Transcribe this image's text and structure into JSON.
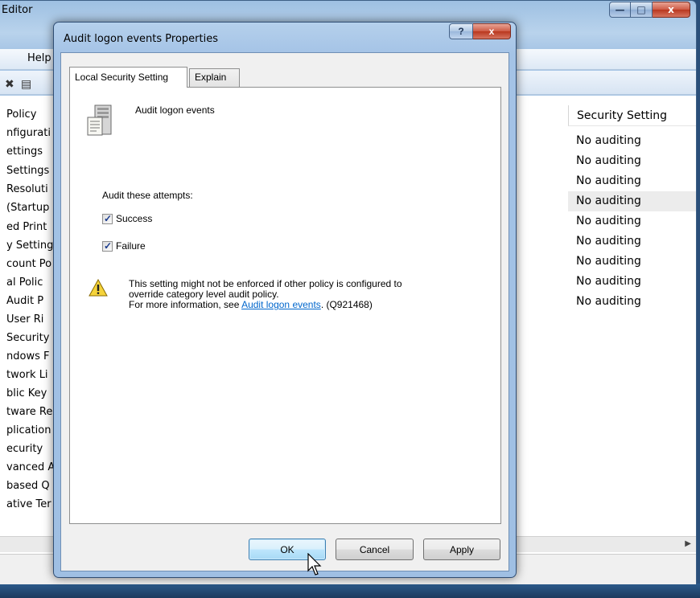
{
  "background_window": {
    "title": "Editor",
    "menu_help": "Help",
    "tree_items": [
      "Policy",
      "nfigurati",
      "ettings",
      "Settings",
      "Resoluti",
      "(Startup",
      "ed Print",
      "y Setting",
      "count Po",
      "al Polic",
      "Audit P",
      "User Ri",
      "Security",
      "ndows F",
      "twork Li",
      "blic Key",
      "tware Re",
      "plication",
      "ecurity",
      "vanced A",
      "based Q",
      "ative Ter"
    ],
    "column_header": "Security Setting",
    "rows": [
      "No auditing",
      "No auditing",
      "No auditing",
      "No auditing",
      "No auditing",
      "No auditing",
      "No auditing",
      "No auditing",
      "No auditing"
    ]
  },
  "dialog": {
    "title": "Audit logon events Properties",
    "help_glyph": "?",
    "close_glyph": "x",
    "tabs": [
      "Local Security Setting",
      "Explain"
    ],
    "active_tab": "Local Security Setting",
    "policy_name": "Audit logon events",
    "attempts_label": "Audit these attempts:",
    "success_label": "Success",
    "success_checked": true,
    "failure_label": "Failure",
    "failure_checked": true,
    "warning": {
      "line1": "This setting might not be enforced if other policy is configured to",
      "line2": "override category level audit policy.",
      "line3_prefix": "For more information, see ",
      "link_text": "Audit logon events",
      "line3_suffix": ". (Q921468)"
    },
    "buttons": {
      "ok": "OK",
      "cancel": "Cancel",
      "apply": "Apply"
    }
  }
}
